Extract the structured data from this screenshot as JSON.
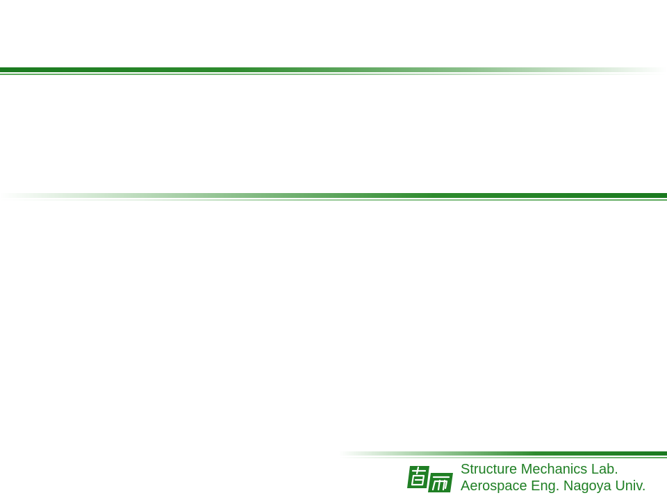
{
  "footer": {
    "line1": "Structure Mechanics Lab.",
    "line2": "Aerospace Eng. Nagoya Univ."
  },
  "logo": {
    "icon": "university-emblem-icon",
    "color": "#1f7f24"
  },
  "colors": {
    "accent_green": "#1a7a1f",
    "text_green": "#1f7f24"
  }
}
